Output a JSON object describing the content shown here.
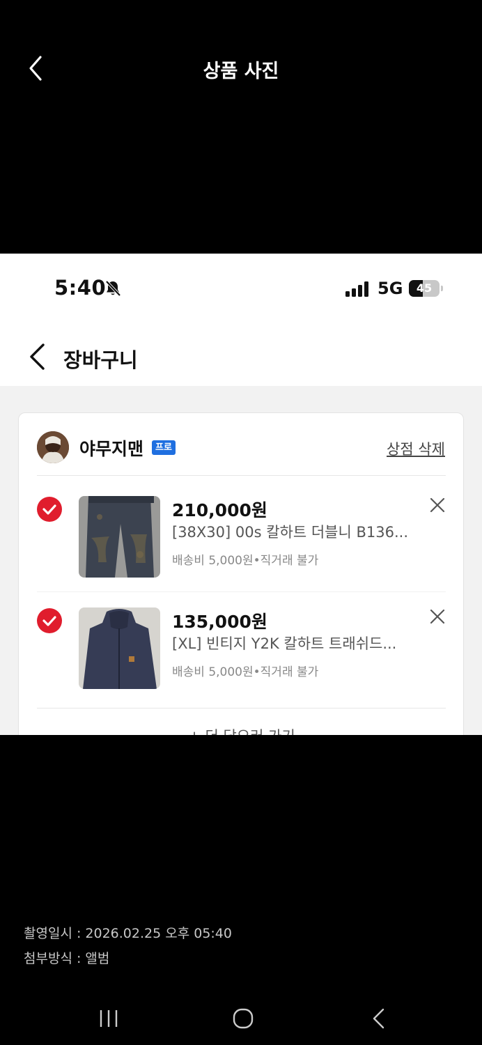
{
  "viewer": {
    "title": "상품 사진",
    "info_shot_time": "촬영일시 : 2026.02.25 오후 05:40",
    "info_attach_method": "첨부방식 : 앨범"
  },
  "status_bar": {
    "time": "5:40",
    "network": "5G",
    "battery": "45",
    "battery_fraction": 0.45
  },
  "nav": {
    "title": "장바구니"
  },
  "shop": {
    "name": "야무지맨",
    "badge": "프로",
    "delete_label": "상점 삭제"
  },
  "items": [
    {
      "price": "210,000원",
      "title": "[38X30] 00s 칼하트 더블니 B136...",
      "meta": "배송비 5,000원•직거래 불가"
    },
    {
      "price": "135,000원",
      "title": "[XL] 빈티지 Y2K 칼하트 트래쉬드...",
      "meta": "배송비 5,000원•직거래 불가"
    }
  ],
  "more_label": "+ 더 담으러 가기",
  "colors": {
    "accent_red": "#e01d2d",
    "pro_badge_blue": "#1f6fe0"
  }
}
